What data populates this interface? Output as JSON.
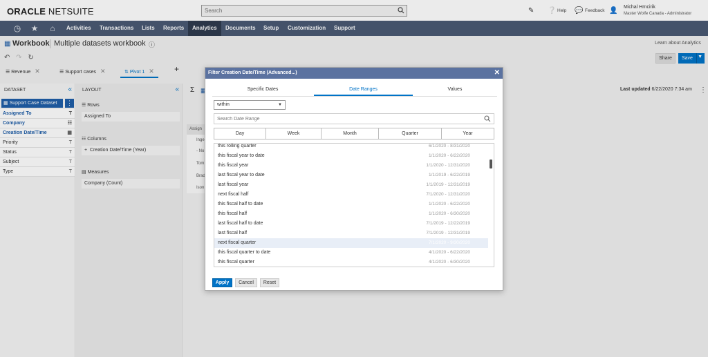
{
  "header": {
    "logo_oracle": "ORACLE",
    "logo_netsuite": "NETSUITE",
    "search_placeholder": "Search",
    "help": "Help",
    "feedback": "Feedback",
    "user_name": "Michal Hrncirik",
    "user_role": "Master Wolfe Canada - Administrator"
  },
  "nav": {
    "items": [
      "Activities",
      "Transactions",
      "Lists",
      "Reports",
      "Analytics",
      "Documents",
      "Setup",
      "Customization",
      "Support"
    ],
    "active": "Analytics"
  },
  "workbook": {
    "title": "Workbook",
    "name": "Multiple datasets workbook",
    "learn_link": "Learn about Analytics",
    "share": "Share",
    "save": "Save"
  },
  "tabs": [
    {
      "label": "Revenue"
    },
    {
      "label": "Support cases"
    },
    {
      "label": "Pivot 1"
    }
  ],
  "dataset": {
    "heading": "DATASET",
    "button": "Support Case Dataset",
    "fields": [
      {
        "label": "Assigned To",
        "type_icon": "T",
        "used": true
      },
      {
        "label": "Company",
        "type_icon": "☷",
        "used": true
      },
      {
        "label": "Creation Date/Time",
        "type_icon": "▦",
        "used": true
      },
      {
        "label": "Priority",
        "type_icon": "T",
        "used": false
      },
      {
        "label": "Status",
        "type_icon": "T",
        "used": false
      },
      {
        "label": "Subject",
        "type_icon": "T",
        "used": false
      },
      {
        "label": "Type",
        "type_icon": "T",
        "used": false
      }
    ]
  },
  "layout": {
    "heading": "LAYOUT",
    "rows_label": "Rows",
    "rows_item": "Assigned To",
    "columns_label": "Columns",
    "columns_item": "Creation Date/Time  (Year)",
    "measures_label": "Measures",
    "measures_item": "Company (Count)"
  },
  "main": {
    "last_updated_label": "Last updated",
    "last_updated_value": "6/22/2020 7:34 am",
    "behind_cells": [
      "Assign",
      "Inge",
      "- No",
      "Tom",
      "Brad",
      "Ison"
    ]
  },
  "modal": {
    "title": "Filter Creation Date/Time (Advanced...)",
    "tabs": [
      "Specific Dates",
      "Date Ranges",
      "Values"
    ],
    "active_tab": "Date Ranges",
    "operator": "within",
    "search_placeholder": "Search Date Range",
    "periods": [
      "Day",
      "Week",
      "Month",
      "Quarter",
      "Year"
    ],
    "ranges": [
      {
        "label": "this rolling quarter",
        "dates": "6/1/2020 - 8/31/2020"
      },
      {
        "label": "this fiscal year to date",
        "dates": "1/1/2020 - 6/22/2020"
      },
      {
        "label": "this fiscal year",
        "dates": "1/1/2020 - 12/31/2020"
      },
      {
        "label": "last fiscal year to date",
        "dates": "1/1/2019 - 6/22/2019"
      },
      {
        "label": "last fiscal year",
        "dates": "1/1/2019 - 12/31/2019"
      },
      {
        "label": "next fiscal half",
        "dates": "7/1/2020 - 12/31/2020"
      },
      {
        "label": "this fiscal half to date",
        "dates": "1/1/2020 - 6/22/2020"
      },
      {
        "label": "this fiscal half",
        "dates": "1/1/2020 - 6/30/2020"
      },
      {
        "label": "last fiscal half to date",
        "dates": "7/1/2019 - 12/22/2019"
      },
      {
        "label": "last fiscal half",
        "dates": "7/1/2019 - 12/31/2019"
      },
      {
        "label": "next fiscal quarter",
        "dates": "7/1/2020 - 9/30/2020"
      },
      {
        "label": "this fiscal quarter to date",
        "dates": "4/1/2020 - 6/22/2020"
      },
      {
        "label": "this fiscal quarter",
        "dates": "4/1/2020 - 6/30/2020"
      }
    ],
    "highlighted_index": 10,
    "apply": "Apply",
    "cancel": "Cancel",
    "reset": "Reset"
  },
  "colors": {
    "nav_bg": "#4a5a74",
    "accent": "#0073c7",
    "modal_header": "#5b72a0"
  }
}
